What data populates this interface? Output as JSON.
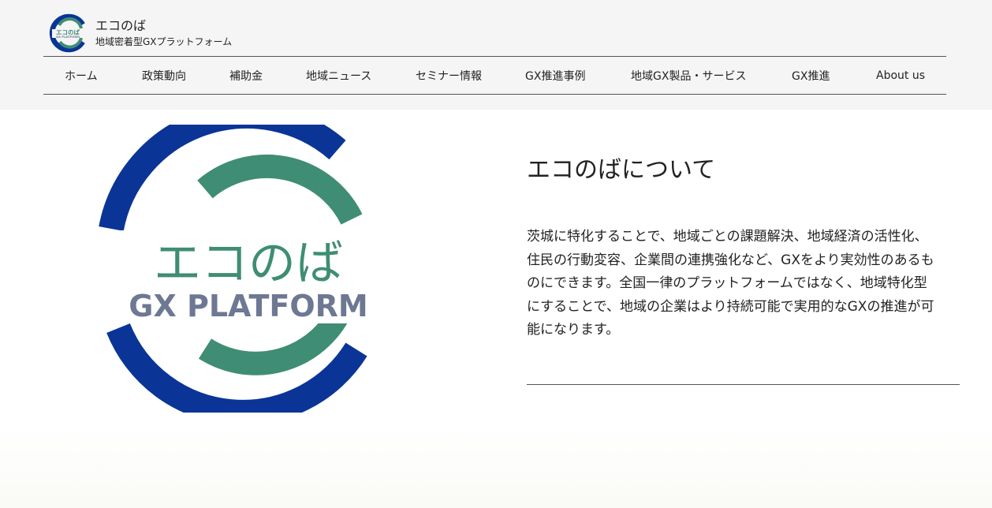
{
  "site": {
    "name": "エコのば",
    "tagline": "地域密着型GXプラットフォーム",
    "logo": {
      "main_text": "エコのば",
      "sub_text": "GX PLATFORM",
      "colors": {
        "blue": "#0a3597",
        "green": "#3f8d74",
        "gray": "#6d7892"
      }
    }
  },
  "nav": {
    "items": [
      {
        "label": "ホーム"
      },
      {
        "label": "政策動向"
      },
      {
        "label": "補助金"
      },
      {
        "label": "地域ニュース"
      },
      {
        "label": "セミナー情報"
      },
      {
        "label": "GX推進事例"
      },
      {
        "label": "地域GX製品・サービス"
      },
      {
        "label": "GX推進"
      },
      {
        "label": "About us"
      }
    ]
  },
  "about": {
    "title": "エコのばについて",
    "lines": [
      "茨城に特化することで、地域ごとの課題解決、地域経済の活性化、",
      "住民の行動変容、企業間の連携強化など、GXをより実効性のあるも",
      "のにできます。全国一律のプラットフォームではなく、地域特化型",
      "にすることで、地域の企業はより持続可能で実用的なGXの推進が可",
      "能になります。"
    ]
  }
}
